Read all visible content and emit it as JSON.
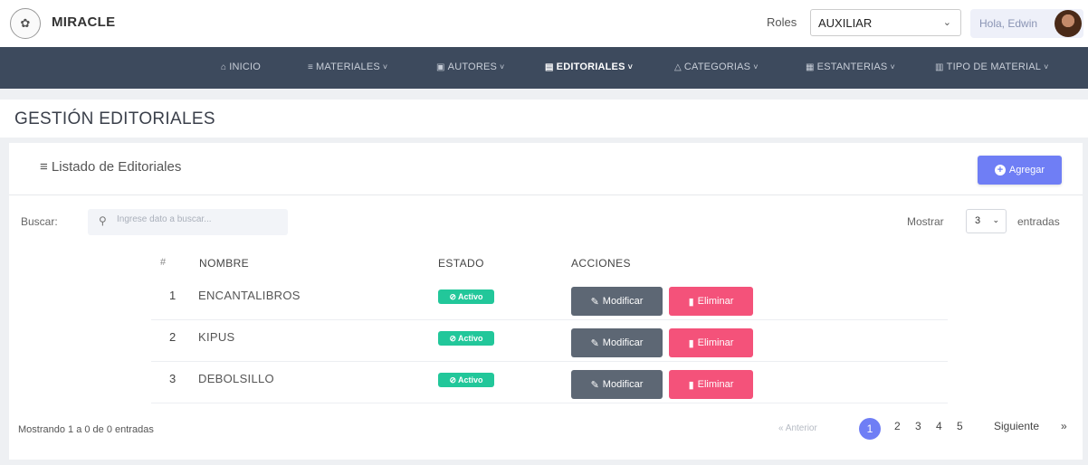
{
  "header": {
    "brand": "MIRACLE",
    "roles_label": "Roles",
    "roles_value": "AUXILIAR",
    "greeting": "Hola, Edwin"
  },
  "nav": {
    "items": [
      {
        "label": "INICIO",
        "icon": "home-icon"
      },
      {
        "label": "MATERIALES",
        "icon": "list-icon"
      },
      {
        "label": "AUTORES",
        "icon": "id-card-icon"
      },
      {
        "label": "EDITORIALES",
        "icon": "book-icon"
      },
      {
        "label": "CATEGORIAS",
        "icon": "shapes-icon"
      },
      {
        "label": "ESTANTERIAS",
        "icon": "shelf-icon"
      },
      {
        "label": "TIPO DE MATERIAL",
        "icon": "books-icon"
      }
    ]
  },
  "page": {
    "title": "GESTIÓN EDITORIALES"
  },
  "card": {
    "list_title": "Listado de Editoriales",
    "add_label": "Agregar",
    "search_label": "Buscar:",
    "search_placeholder": "Ingrese dato a buscar...",
    "show_label": "Mostrar",
    "show_value": "3",
    "entries_label": "entradas"
  },
  "table": {
    "headers": {
      "num": "#",
      "name": "NOMBRE",
      "state": "ESTADO",
      "actions": "ACCIONES"
    },
    "rows": [
      {
        "num": "1",
        "name": "ENCANTALIBROS",
        "state": "Activo",
        "modify": "Modificar",
        "delete": "Eliminar"
      },
      {
        "num": "2",
        "name": "KIPUS",
        "state": "Activo",
        "modify": "Modificar",
        "delete": "Eliminar"
      },
      {
        "num": "3",
        "name": "DEBOLSILLO",
        "state": "Activo",
        "modify": "Modificar",
        "delete": "Eliminar"
      }
    ]
  },
  "footer": {
    "showing": "Mostrando 1 a 0 de 0 entradas",
    "prev": "« Anterior",
    "pages": [
      "1",
      "2",
      "3",
      "4",
      "5"
    ],
    "next": "Siguiente",
    "next_arrow": "»"
  },
  "colors": {
    "nav_bg": "#3d4a5d",
    "primary": "#6f7ef5",
    "success": "#22c79a",
    "danger": "#f4527a",
    "secondary": "#5d6774"
  }
}
